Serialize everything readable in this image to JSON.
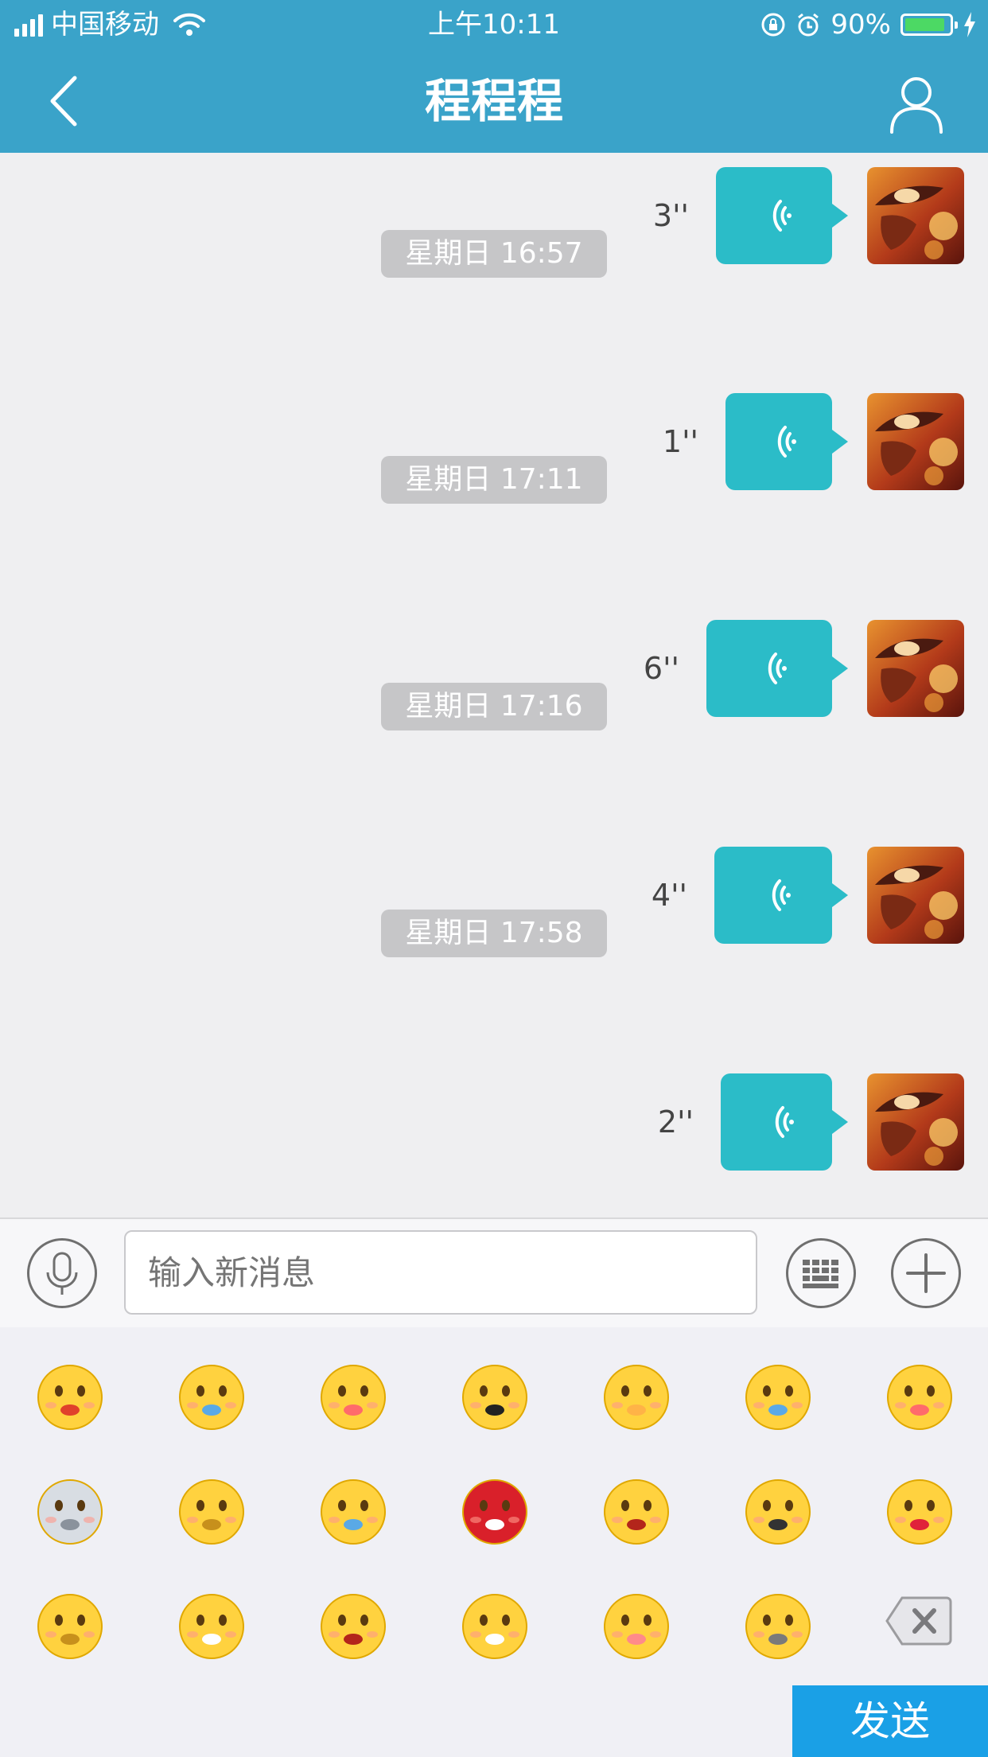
{
  "status_bar": {
    "carrier": "中国移动",
    "time": "上午10:11",
    "battery_percent": "90%",
    "battery_level": 0.9
  },
  "nav": {
    "title": "程程程",
    "back_icon": "chevron-left-icon",
    "profile_icon": "user-icon"
  },
  "messages": [
    {
      "type": "voice",
      "duration": "3''"
    },
    {
      "type": "timestamp",
      "text": "星期日 16:57"
    },
    {
      "type": "voice",
      "duration": "1''"
    },
    {
      "type": "timestamp",
      "text": "星期日 17:11"
    },
    {
      "type": "voice",
      "duration": "6''"
    },
    {
      "type": "timestamp",
      "text": "星期日 17:16"
    },
    {
      "type": "voice",
      "duration": "4''"
    },
    {
      "type": "timestamp",
      "text": "星期日 17:58"
    },
    {
      "type": "voice",
      "duration": "2''"
    }
  ],
  "input_bar": {
    "placeholder": "输入新消息",
    "voice_icon": "microphone-icon",
    "keyboard_icon": "keyboard-icon",
    "plus_icon": "plus-icon"
  },
  "emoji_panel": {
    "emojis": [
      "shy-heart",
      "crying",
      "tongue-out",
      "ten-thousand-yuan",
      "pray",
      "sweat-sigh",
      "smirk-sparkle",
      "robot",
      "frown-fists",
      "shocked-sweat",
      "angry-devil",
      "laughing",
      "smile",
      "heart-eyes",
      "thinking",
      "mouth-taped",
      "yawn",
      "face-mask",
      "blush-eyes-up",
      "facepalm"
    ],
    "delete_icon": "backspace-icon",
    "send_label": "发送"
  },
  "colors": {
    "header": "#3aa3c9",
    "bubble": "#2bbcc8",
    "send_button": "#1aa0e6",
    "timestamp_bg": "#c6c6c8"
  }
}
